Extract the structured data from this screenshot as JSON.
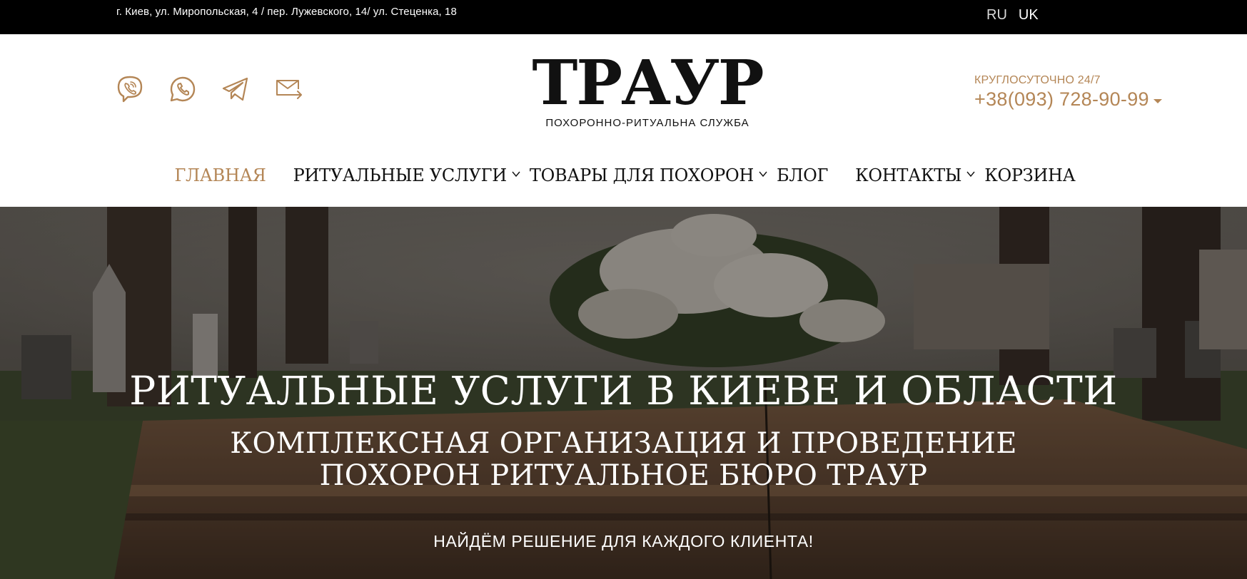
{
  "topbar": {
    "address": "г. Киев, ул. Миропольская, 4 / пер. Лужевского, 14/ ул. Стеценка, 18",
    "languages": [
      {
        "label": "RU",
        "active": true
      },
      {
        "label": "UK",
        "active": false
      }
    ]
  },
  "header": {
    "social_icons": [
      "viber-icon",
      "whatsapp-icon",
      "telegram-icon",
      "email-icon"
    ],
    "logo": {
      "wordmark": "ТРАУР",
      "tagline": "ПОХОРОННО-РИТУАЛЬНА СЛУЖБА"
    },
    "contact": {
      "hours": "КРУГЛОСУТОЧНО 24/7",
      "phone": "+38(093) 728-90-99"
    }
  },
  "nav": {
    "items": [
      {
        "label": "ГЛАВНАЯ",
        "active": true,
        "dropdown": false
      },
      {
        "label": "РИТУАЛЬНЫЕ УСЛУГИ",
        "active": false,
        "dropdown": true
      },
      {
        "label": "ТОВАРЫ ДЛЯ ПОХОРОН",
        "active": false,
        "dropdown": true
      },
      {
        "label": "БЛОГ",
        "active": false,
        "dropdown": false
      },
      {
        "label": "КОНТАКТЫ",
        "active": false,
        "dropdown": true
      },
      {
        "label": "КОРЗИНА",
        "active": false,
        "dropdown": false
      }
    ]
  },
  "hero": {
    "title": "РИТУАЛЬНЫЕ УСЛУГИ В КИЕВЕ И ОБЛАСТИ",
    "subtitle_line1": "КОМПЛЕКСНАЯ ОРГАНИЗАЦИЯ И ПРОВЕДЕНИЕ",
    "subtitle_line2": "ПОХОРОН РИТУАЛЬНОЕ БЮРО ТРАУР",
    "note": "НАЙДЁМ РЕШЕНИЕ ДЛЯ КАЖДОГО КЛИЕНТА!"
  },
  "colors": {
    "accent": "#b48656",
    "topbar_bg": "#000000",
    "text_dark": "#111111"
  }
}
